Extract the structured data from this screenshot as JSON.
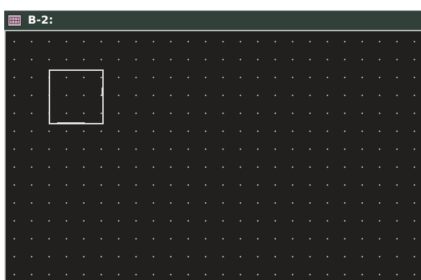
{
  "window": {
    "title": "B-2:",
    "title_icon": "diagram-window-icon",
    "colors": {
      "titlebar": "#31413a",
      "canvas": "#221f1f",
      "grid_dot": "#e8e8e8",
      "module_outline": "#e4e4e4"
    }
  },
  "canvas": {
    "grid": true
  }
}
